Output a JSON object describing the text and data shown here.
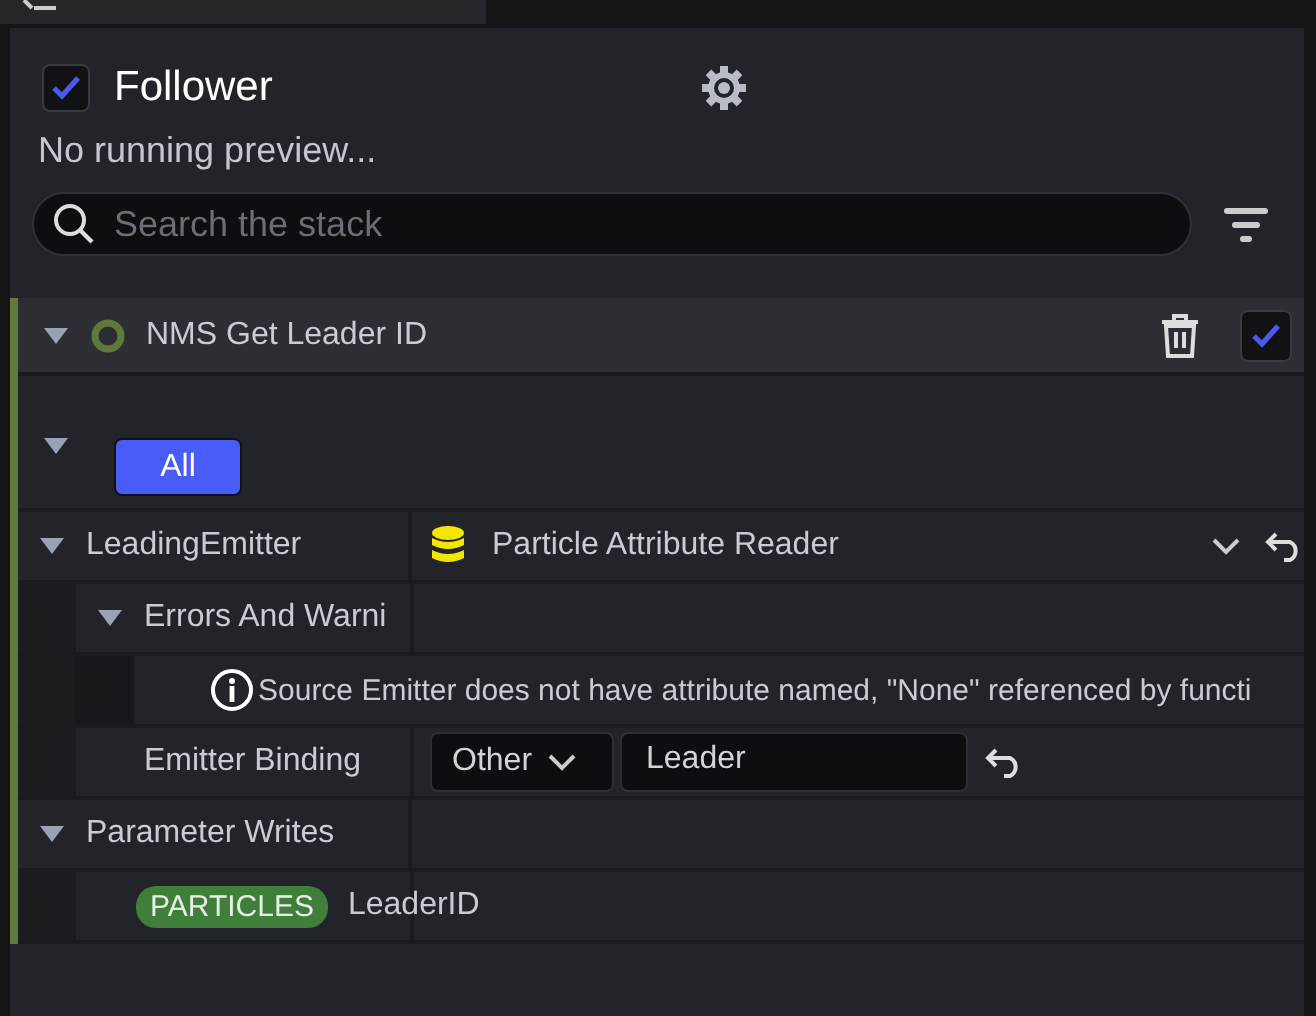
{
  "emitter": {
    "name": "Follower",
    "enabled": true
  },
  "preview_status": "No running preview...",
  "search": {
    "placeholder": "Search the stack"
  },
  "module": {
    "name": "NMS Get Leader ID",
    "expanded": true,
    "enabled": true
  },
  "filter": {
    "expanded": true,
    "label": "All",
    "selected": true
  },
  "rows": [
    {
      "kind": "data_interface",
      "label": "LeadingEmitter",
      "expanded": true,
      "value": "Particle Attribute Reader",
      "children": [
        {
          "kind": "category",
          "label": "Errors And Warni",
          "expanded": true,
          "children": [
            {
              "kind": "message",
              "text": "Source Emitter does not have attribute named, \"None\" referenced by functi"
            }
          ]
        },
        {
          "kind": "binding",
          "label": "Emitter Binding",
          "mode": "Other",
          "value": "Leader"
        }
      ]
    },
    {
      "kind": "category",
      "label": "Parameter Writes",
      "expanded": true,
      "children": [
        {
          "kind": "write",
          "namespace": "PARTICLES",
          "label": "LeaderID"
        }
      ]
    }
  ]
}
